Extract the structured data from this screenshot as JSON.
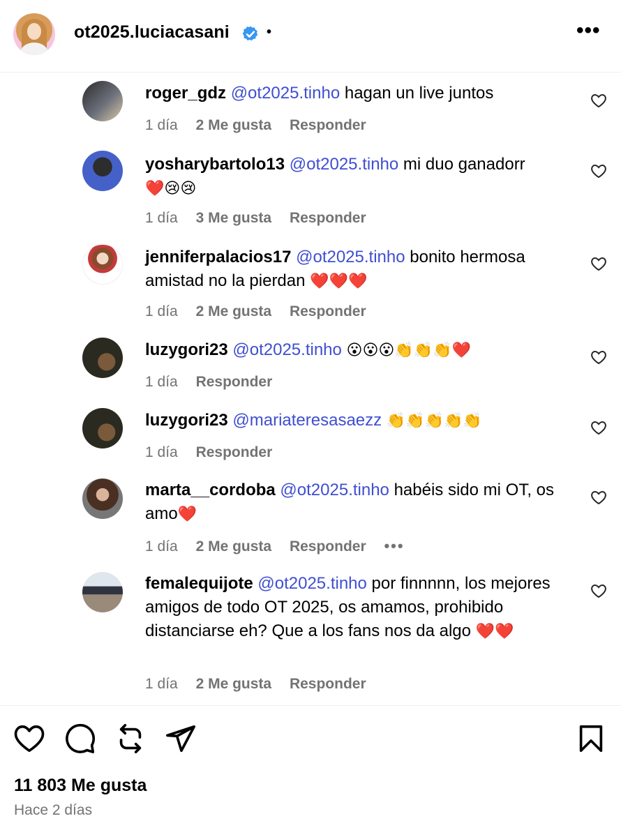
{
  "post": {
    "username": "ot2025.luciacasani",
    "verified": true,
    "dot": "•",
    "more_label": "•••"
  },
  "colors": {
    "mention": "#3f4fd0",
    "meta": "#737373",
    "verified": "#3897f0",
    "heart_red": "#e0245e"
  },
  "comments": [
    {
      "user": "roger_gdz",
      "mention": "@ot2025.tinho",
      "text": " hagan un live juntos",
      "emojis": "",
      "time": "1 día",
      "likes": "2 Me gusta",
      "reply": "Responder",
      "more": ""
    },
    {
      "user": "yosharybartolo13",
      "mention": "@ot2025.tinho",
      "text": " mi duo ganadorr",
      "emojis": "❤️😢😢",
      "time": "1 día",
      "likes": "3 Me gusta",
      "reply": "Responder",
      "more": ""
    },
    {
      "user": "jenniferpalacios17",
      "mention": "@ot2025.tinho",
      "text": " bonito hermosa amistad no la pierdan",
      "emojis": "❤️❤️❤️",
      "time": "1 día",
      "likes": "2 Me gusta",
      "reply": "Responder",
      "more": ""
    },
    {
      "user": "luzygori23",
      "mention": "@ot2025.tinho",
      "text": "",
      "emojis": "😮😮😮👏👏👏❤️",
      "time": "1 día",
      "likes": "",
      "reply": "Responder",
      "more": ""
    },
    {
      "user": "luzygori23",
      "mention": "@mariateresasaezz",
      "text": "",
      "emojis": "👏👏👏👏👏",
      "time": "1 día",
      "likes": "",
      "reply": "Responder",
      "more": ""
    },
    {
      "user": "marta__cordoba",
      "mention": "@ot2025.tinho",
      "text": " habéis sido mi OT, os amo",
      "emojis": "❤️",
      "time": "1 día",
      "likes": "2 Me gusta",
      "reply": "Responder",
      "more": "•••"
    },
    {
      "user": "femalequijote",
      "mention": "@ot2025.tinho",
      "text": " por finnnnn, los mejores amigos de todo OT 2025, os amamos, prohibido distanciarse eh? Que a los fans nos da algo",
      "emojis": "❤️❤️",
      "time": "1 día",
      "likes": "2 Me gusta",
      "reply": "Responder",
      "more": ""
    }
  ],
  "footer": {
    "likes": "11 803 Me gusta",
    "timestamp": "Hace 2 días"
  },
  "icons": {
    "like": "heart-icon",
    "comment": "comment-icon",
    "repost": "repost-icon",
    "share": "share-icon",
    "save": "bookmark-icon"
  }
}
